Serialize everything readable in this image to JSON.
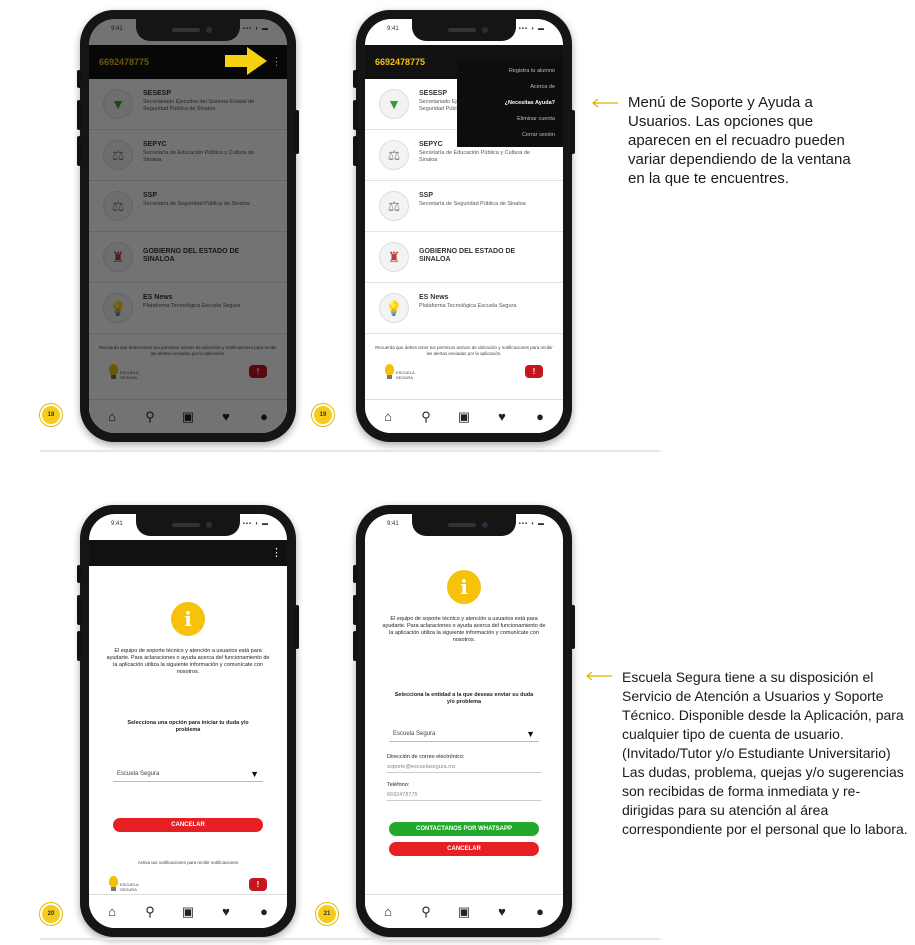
{
  "colors": {
    "accent_yellow": "#f4c20d",
    "danger_red": "#e81e25",
    "success_green": "#22a82a",
    "appbar_black": "#111111"
  },
  "status_bar": {
    "time": "9:41",
    "signal": "▪▪▪ ◗ ▬"
  },
  "appbar": {
    "phone_number": "6692478775",
    "menu_icon": "kebab-icon"
  },
  "entities": [
    {
      "name": "SESESP",
      "desc": "Secretariado Ejecutivo del Sistema Estatal de Seguridad Pública de Sinaloa",
      "icon": "shield-icon",
      "glyph": "▼"
    },
    {
      "name": "SEPYC",
      "desc": "Secretaría de Educación Pública y Cultura de Sinaloa",
      "icon": "seal-icon",
      "glyph": "⚖"
    },
    {
      "name": "SSP",
      "desc": "Secretaría de Seguridad Pública de Sinaloa",
      "icon": "seal-icon",
      "glyph": "⚖"
    },
    {
      "name": "GOBIERNO DEL ESTADO DE SINALOA",
      "desc": "",
      "icon": "government-icon",
      "glyph": "♜"
    },
    {
      "name": "ES News",
      "desc": "Plataforma Tecnológica Escuela Segura",
      "icon": "bulb-icon",
      "glyph": "💡"
    }
  ],
  "footnote": "Recuerda que debes tener tus permisos activos de ubicación y notificaciones para recibir las alertas enviadas por la aplicación.",
  "brand": {
    "text": "ESCUELA SEGURA",
    "badge": "!"
  },
  "menu": {
    "items": [
      "Registra tu alumno",
      "Acerca de",
      "¿Necesitas Ayuda?",
      "Eliminar cuenta",
      "Cerrar sesión"
    ]
  },
  "support_screen_20": {
    "paragraph": "El equipo de soporte técnico y atención a usuarios está para ayudarte. Para aclaraciones o ayuda acerca del funcionamiento de la aplicación utiliza la siguiente información y comunícate con nosotros.",
    "prompt": "Selecciona una opción para iniciar tu duda y/o problema",
    "select_value": "Escuela Segura",
    "cancel": "CANCELAR",
    "footnote": "Activa tus notificaciones para recibir notificaciones"
  },
  "support_screen_21": {
    "paragraph": "El equipo de soporte técnico y atención a usuarios está para ayudarte. Para aclaraciones o ayuda acerca del funcionamiento de la aplicación utiliza la siguiente información y comunícate con nosotros.",
    "prompt": "Selecciona la entidad a la que deseas enviar su duda y/o problema",
    "select_value": "Escuela Segura",
    "email_label": "Dirección de correo electrónico:",
    "email_value": "soporte@escuelasegura.mx",
    "phone_label": "Teléfono:",
    "phone_value": "6692478775",
    "contact": "CONTACTANOS POR WHATSAPP",
    "cancel": "CANCELAR"
  },
  "steps": [
    "18",
    "19",
    "20",
    "21"
  ],
  "captions": {
    "top": "Menú de Soporte y Ayuda a Usuarios. Las opciones que aparecen en el recuadro pueden variar dependiendo de la ventana en la que te encuentres.",
    "bottom": "Escuela Segura tiene a su disposición el Servicio de Atención a Usuarios y Soporte Técnico. Disponible desde la Aplicación, para cualquier tipo de cuenta de usuario. (Invitado/Tutor y/o Estudiante Universitario) Las dudas, problema, quejas y/o sugerencias son recibidas de forma inmediata y re-dirigidas para su atención al área correspondiente por el personal que lo labora."
  },
  "nav": [
    "home-icon",
    "search-icon",
    "plus-square-icon",
    "heart-icon",
    "profile-icon"
  ]
}
